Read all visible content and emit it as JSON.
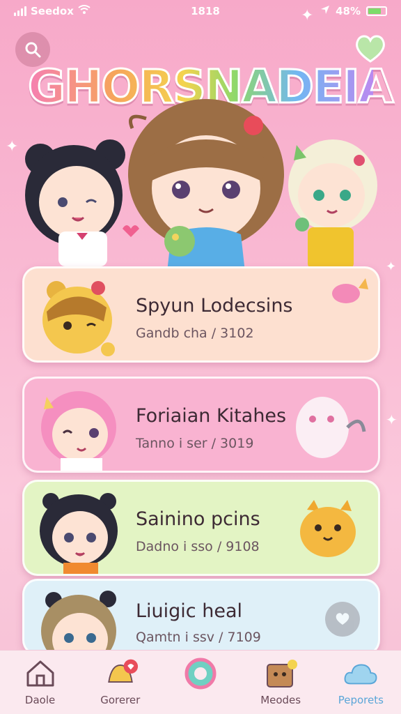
{
  "status_bar": {
    "carrier": "Seedox",
    "time": "1818",
    "battery": "48%"
  },
  "header": {
    "logo_text": "GHORSNADEIA",
    "search_icon": "search-icon",
    "heart_icon": "heart-icon"
  },
  "cards": [
    {
      "title": "Spyun Lodecsins",
      "subtitle": "Gandb cha / 3102",
      "color": "#fde0d0",
      "art": "bear-character"
    },
    {
      "title": "Foriaian Kitahes",
      "subtitle": "Tanno i ser / 3019",
      "color": "#f9b3d1",
      "art": "pink-hair-girl"
    },
    {
      "title": "Sainino pcins",
      "subtitle": "Dadno i sso / 9108",
      "color": "#e3f4c4",
      "art": "black-hair-girl"
    },
    {
      "title": "Liuigic heal",
      "subtitle": "Qamtn i ssv / 7109",
      "color": "#dff0f8",
      "art": "brown-hair-girl"
    }
  ],
  "nav": [
    {
      "label": "Daole",
      "icon": "home-icon"
    },
    {
      "label": "Gorerer",
      "icon": "bell-icon"
    },
    {
      "label": "",
      "icon": "world-icon"
    },
    {
      "label": "Meodes",
      "icon": "box-icon"
    },
    {
      "label": "Peporets",
      "icon": "cloud-icon"
    }
  ],
  "colors": {
    "background": "#f7a9c9",
    "nav_active": "#5aa6d8"
  }
}
